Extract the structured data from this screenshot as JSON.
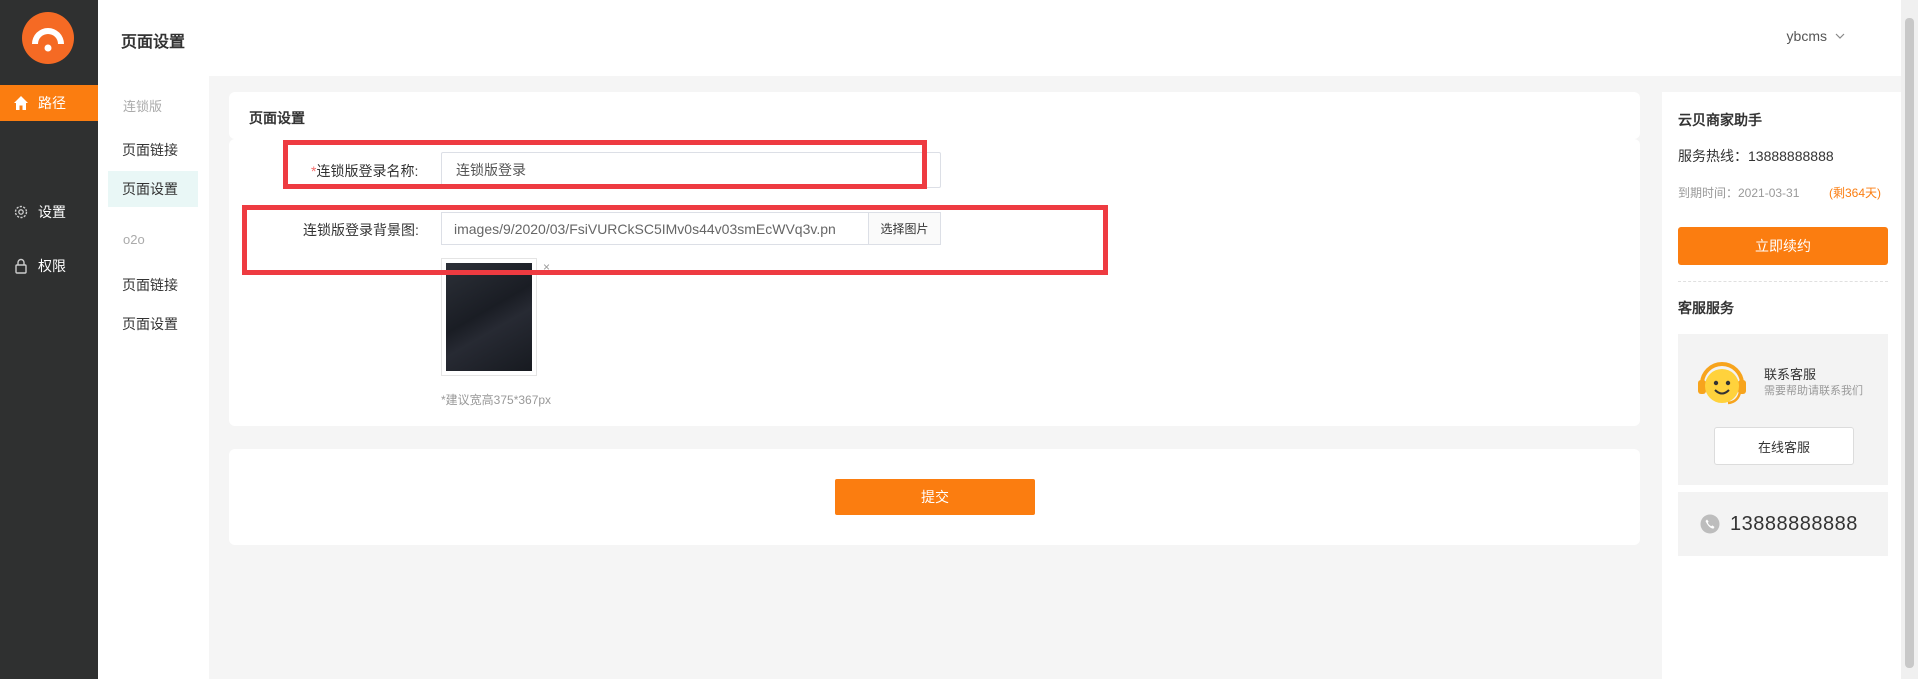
{
  "rail": {
    "items": [
      {
        "label": "路径",
        "icon": "home-icon"
      },
      {
        "label": "设置",
        "icon": "gear-icon"
      },
      {
        "label": "权限",
        "icon": "lock-icon"
      }
    ]
  },
  "header": {
    "title": "页面设置",
    "user": "ybcms"
  },
  "subnav": {
    "group1": "连锁版",
    "group1_items": [
      "页面链接",
      "页面设置"
    ],
    "group2": "o2o",
    "group2_items": [
      "页面链接",
      "页面设置"
    ]
  },
  "form": {
    "card_title": "页面设置",
    "required_mark": "*",
    "login_name_label": "连锁版登录名称:",
    "login_name_value": "连锁版登录",
    "bg_label": "连锁版登录背景图:",
    "bg_path": "images/9/2020/03/FsiVURCkSC5IMv0s44v03smEcWVq3v.pn",
    "pick_button": "选择图片",
    "remove_mark": "×",
    "hint": "*建议宽高375*367px",
    "submit": "提交"
  },
  "assistant": {
    "title": "云贝商家助手",
    "hotline": "服务热线：13888888888",
    "expire": "到期时间：2021-03-31",
    "remain": "(剩364天)",
    "renew": "立即续约",
    "service_title": "客服服务",
    "contact_name": "联系客服",
    "contact_sub": "需要帮助请联系我们",
    "online_button": "在线客服",
    "phone": "13888888888"
  },
  "colors": {
    "accent": "#fb7d10",
    "rail_bg": "#2f3030",
    "highlight": "#ee3b41"
  }
}
